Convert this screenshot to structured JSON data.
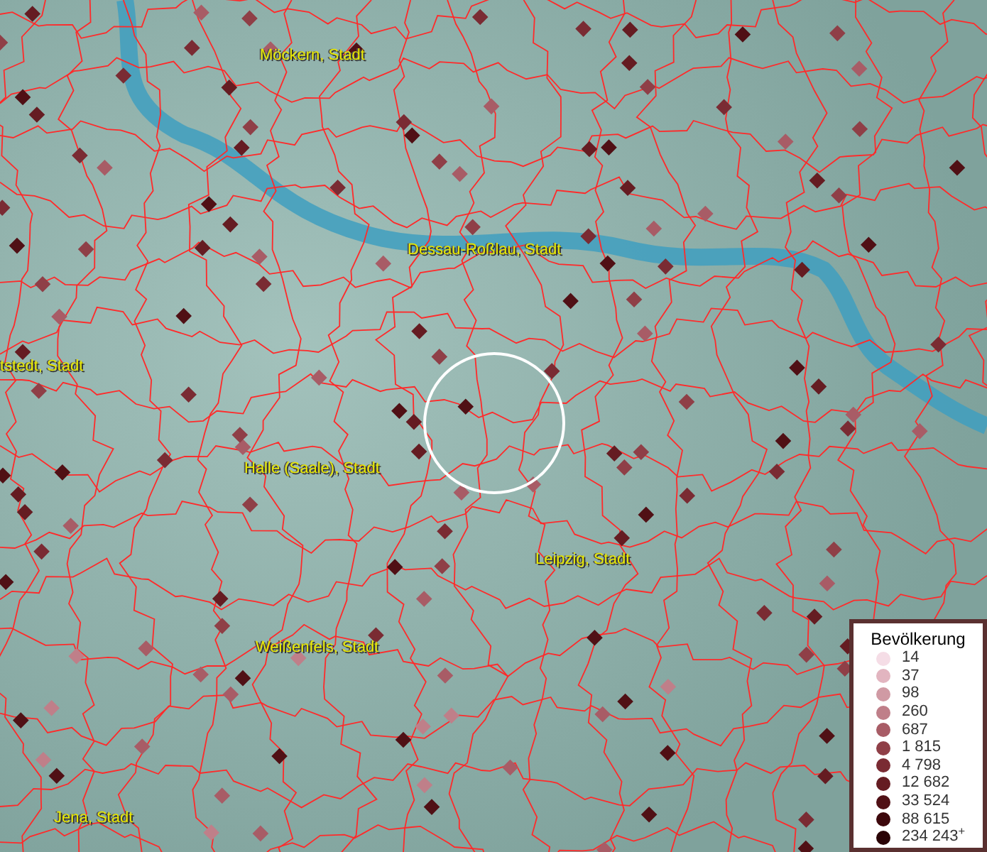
{
  "map": {
    "places": [
      {
        "name": "Möckern, Stadt"
      },
      {
        "name": "Dessau-Roßlau, Stadt"
      },
      {
        "name": "tstedt, Stadt"
      },
      {
        "name": "Halle (Saale), Stadt"
      },
      {
        "name": "Leipzig, Stadt"
      },
      {
        "name": "Weißenfels, Stadt"
      },
      {
        "name": "Jena, Stadt"
      }
    ]
  },
  "legend": {
    "title": "Bevölkerung",
    "items": [
      {
        "label": "14",
        "color": "#f5dde6"
      },
      {
        "label": "37",
        "color": "#e2b5c0"
      },
      {
        "label": "98",
        "color": "#d09aa4"
      },
      {
        "label": "260",
        "color": "#bf7f89"
      },
      {
        "label": "687",
        "color": "#a85c66"
      },
      {
        "label": "1 815",
        "color": "#8f3f47"
      },
      {
        "label": "4 798",
        "color": "#7a2b33"
      },
      {
        "label": "12 682",
        "color": "#651c22"
      },
      {
        "label": "33 524",
        "color": "#501015"
      },
      {
        "label": "88 615",
        "color": "#3d080c"
      },
      {
        "label": "234 243$^{+}$",
        "color": "#2a0306"
      }
    ]
  }
}
